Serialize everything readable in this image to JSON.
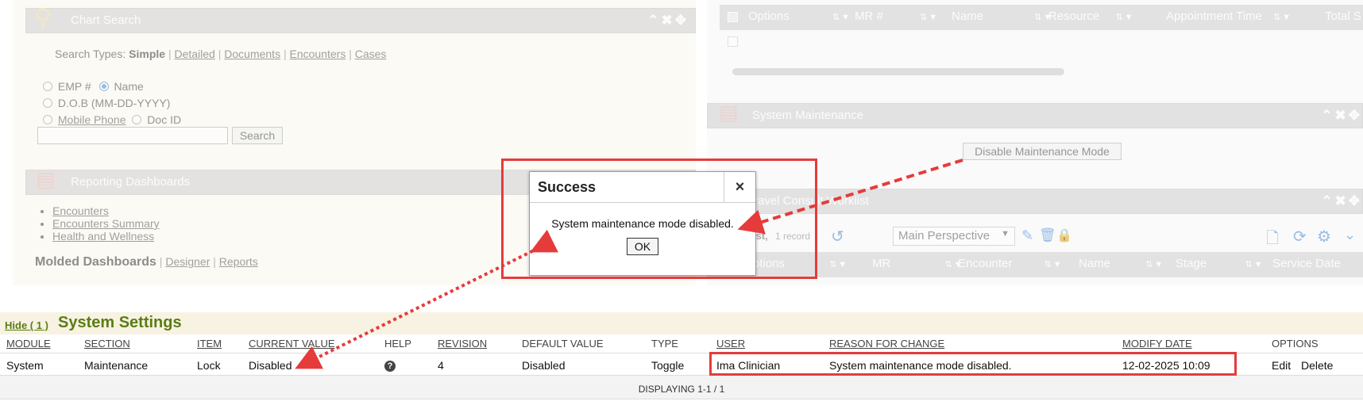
{
  "chart_search": {
    "title": "Chart Search",
    "search_types_label": "Search Types:",
    "types": [
      "Simple",
      "Detailed",
      "Documents",
      "Encounters",
      "Cases"
    ],
    "emp_label": "EMP #",
    "name_label": "Name",
    "dob_label": "D.O.B (MM-DD-YYYY)",
    "mobile_label": "Mobile Phone",
    "docid_label": "Doc ID",
    "search_button": "Search"
  },
  "reporting": {
    "title": "Reporting Dashboards",
    "links": [
      "Encounters",
      "Encounters Summary",
      "Health and Wellness"
    ],
    "molded_label": "Molded Dashboards",
    "designer_link": "Designer",
    "reports_link": "Reports"
  },
  "top_grid": {
    "columns": [
      "Options",
      "MR #",
      "Name",
      "Resource",
      "Appointment Time",
      "Total S"
    ]
  },
  "system_maintenance": {
    "title": "System Maintenance",
    "button": "Disable Maintenance Mode"
  },
  "worklist": {
    "title": "ravel Consult Worklist",
    "list_label": "ist,",
    "record_count": "1 record",
    "perspective": "Main Perspective",
    "columns": [
      "ptions",
      "MR",
      "Encounter",
      "Name",
      "Stage",
      "Service Date"
    ]
  },
  "dialog": {
    "title": "Success",
    "close": "×",
    "message": "System maintenance mode disabled.",
    "ok": "OK"
  },
  "settings": {
    "hide_label": "Hide ( 1 )",
    "title": "System Settings",
    "headers": {
      "module": "MODULE",
      "section": "SECTION",
      "item": "ITEM",
      "current_value": "CURRENT VALUE",
      "help": "HELP",
      "revision": "REVISION",
      "default_value": "DEFAULT VALUE",
      "type": "TYPE",
      "user": "USER",
      "reason": "REASON FOR CHANGE",
      "modify_date": "MODIFY DATE",
      "options": "OPTIONS"
    },
    "row": {
      "module": "System",
      "section": "Maintenance",
      "item": "Lock",
      "current_value": "Disabled",
      "revision": "4",
      "default_value": "Disabled",
      "type": "Toggle",
      "user": "Ima Clinician",
      "reason": "System maintenance mode disabled.",
      "modify_date": "12-02-2025 10:09",
      "edit": "Edit",
      "delete": "Delete"
    },
    "footer": "DISPLAYING 1-1 / 1"
  },
  "colors": {
    "annotation_red": "#e63b3b",
    "settings_green": "#5a7d14",
    "header_gray": "#cfcfcf"
  }
}
